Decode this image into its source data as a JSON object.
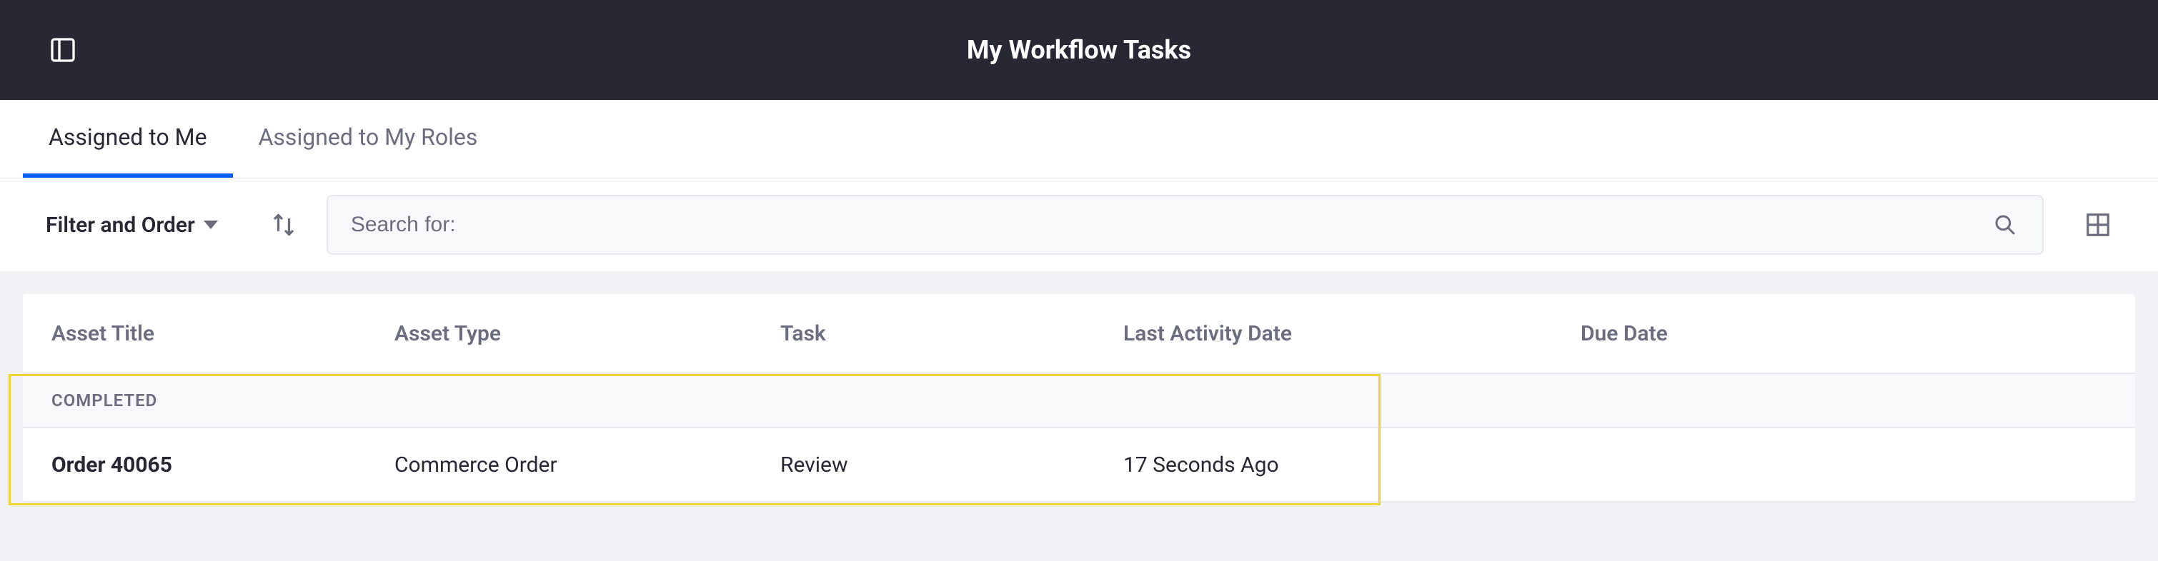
{
  "header": {
    "title": "My Workflow Tasks"
  },
  "tabs": [
    {
      "label": "Assigned to Me",
      "active": true
    },
    {
      "label": "Assigned to My Roles",
      "active": false
    }
  ],
  "toolbar": {
    "filter_label": "Filter and Order",
    "search_placeholder": "Search for:"
  },
  "table": {
    "columns": [
      "Asset Title",
      "Asset Type",
      "Task",
      "Last Activity Date",
      "Due Date"
    ],
    "group_label": "COMPLETED",
    "rows": [
      {
        "asset_title": "Order 40065",
        "asset_type": "Commerce Order",
        "task": "Review",
        "last_activity": "17 Seconds Ago",
        "due_date": ""
      }
    ]
  }
}
